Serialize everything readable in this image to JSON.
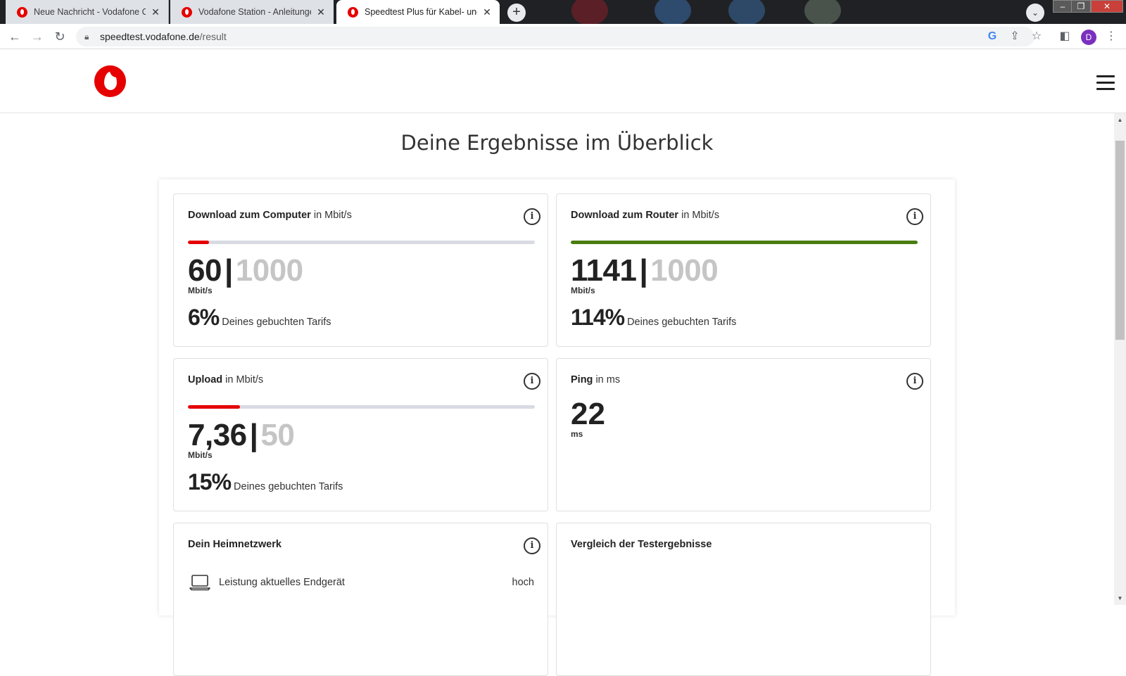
{
  "browser": {
    "tabs": [
      {
        "label": "Neue Nachricht - Vodafone Com",
        "active": false
      },
      {
        "label": "Vodafone Station - Anleitungen &",
        "active": false
      },
      {
        "label": "Speedtest Plus für Kabel- und DSL",
        "active": true
      }
    ],
    "new_tab": "+",
    "url_host": "speedtest.vodafone.de",
    "url_path": "/result",
    "profile_initial": "D"
  },
  "page": {
    "title": "Deine Ergebnisse im Überblick"
  },
  "cards": {
    "download_computer": {
      "title": "Download zum Computer",
      "unit_label": "in Mbit/s",
      "measured": "60",
      "tariff": "1000",
      "unit": "Mbit/s",
      "percent": "6%",
      "percent_text": "Deines gebuchten Tarifs",
      "fill": 0.06,
      "bar_color": "#e60000"
    },
    "download_router": {
      "title": "Download zum Router",
      "unit_label": "in Mbit/s",
      "measured": "1141",
      "tariff": "1000",
      "unit": "Mbit/s",
      "percent": "114%",
      "percent_text": "Deines gebuchten Tarifs",
      "fill": 1.0,
      "bar_color": "#4a7c10"
    },
    "upload": {
      "title": "Upload",
      "unit_label": "in Mbit/s",
      "measured": "7,36",
      "tariff": "50",
      "unit": "Mbit/s",
      "percent": "15%",
      "percent_text": "Deines gebuchten Tarifs",
      "fill": 0.15,
      "bar_color": "#e60000"
    },
    "ping": {
      "title": "Ping",
      "unit_label": "in ms",
      "value": "22",
      "unit": "ms"
    },
    "home_network": {
      "title": "Dein Heimnetzwerk",
      "row_label": "Leistung aktuelles Endgerät",
      "row_value": "hoch"
    },
    "comparison": {
      "title": "Vergleich der Testergebnisse"
    }
  },
  "colors": {
    "brand_red": "#e60000",
    "good_green": "#4a7c10",
    "bar_track": "#d8dbe3"
  },
  "icons": {
    "info": "i",
    "separator": "|"
  }
}
